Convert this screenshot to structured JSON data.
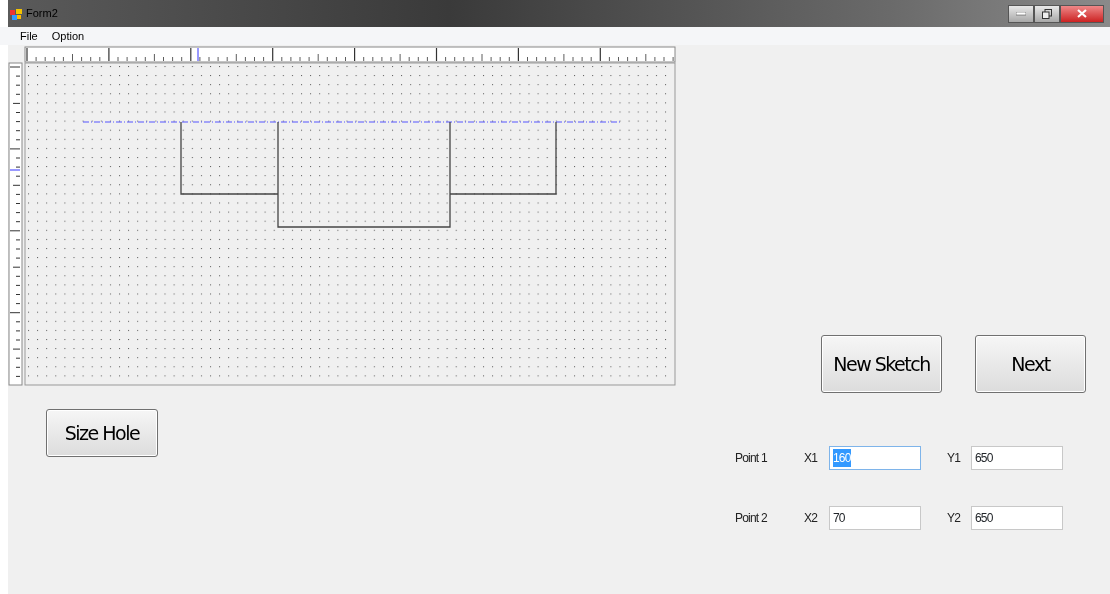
{
  "window": {
    "title": "Form2"
  },
  "menu": [
    "File",
    "Option"
  ],
  "sketch": {
    "kind": "profile"
  },
  "buttons": {
    "new_sketch": "New Sketch",
    "next": "Next",
    "size_hole": "Size Hole"
  },
  "points": [
    {
      "label": "Point 1",
      "x_label": "X1",
      "x_value": "160",
      "x_focused": true,
      "y_label": "Y1",
      "y_value": "650",
      "y_focused": false
    },
    {
      "label": "Point 2",
      "x_label": "X2",
      "x_value": "70",
      "x_focused": false,
      "y_label": "Y2",
      "y_value": "650",
      "y_focused": false
    }
  ]
}
